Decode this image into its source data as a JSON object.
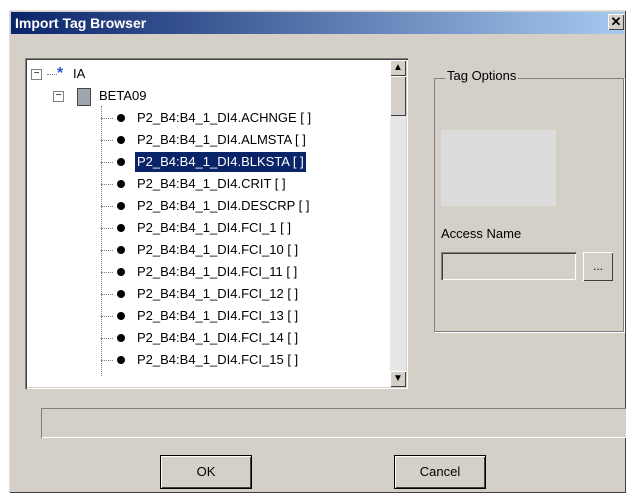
{
  "window": {
    "title": "Import Tag Browser",
    "close_glyph": "✕"
  },
  "tree": {
    "root_label": "IA",
    "root_icon": "asterisk-icon",
    "child_label": "BETA09",
    "child_icon": "server-icon",
    "items": [
      {
        "label": "P2_B4:B4_1_DI4.ACHNGE [ ]",
        "selected": false
      },
      {
        "label": "P2_B4:B4_1_DI4.ALMSTA [ ]",
        "selected": false
      },
      {
        "label": "P2_B4:B4_1_DI4.BLKSTA [ ]",
        "selected": true
      },
      {
        "label": "P2_B4:B4_1_DI4.CRIT [ ]",
        "selected": false
      },
      {
        "label": "P2_B4:B4_1_DI4.DESCRP [ ]",
        "selected": false
      },
      {
        "label": "P2_B4:B4_1_DI4.FCI_1 [ ]",
        "selected": false
      },
      {
        "label": "P2_B4:B4_1_DI4.FCI_10 [ ]",
        "selected": false
      },
      {
        "label": "P2_B4:B4_1_DI4.FCI_11 [ ]",
        "selected": false
      },
      {
        "label": "P2_B4:B4_1_DI4.FCI_12 [ ]",
        "selected": false
      },
      {
        "label": "P2_B4:B4_1_DI4.FCI_13 [ ]",
        "selected": false
      },
      {
        "label": "P2_B4:B4_1_DI4.FCI_14 [ ]",
        "selected": false
      },
      {
        "label": "P2_B4:B4_1_DI4.FCI_15 [ ]",
        "selected": false
      }
    ]
  },
  "options": {
    "group_label": "Tag Options",
    "access_name_label": "Access Name",
    "access_name_value": "",
    "browse_label": "..."
  },
  "buttons": {
    "ok_label": "OK",
    "cancel_label": "Cancel"
  },
  "colors": {
    "title_bar_start": "#0a246a",
    "title_bar_end": "#a6caf0",
    "selection": "#0a246a",
    "face": "#d4d0c8"
  }
}
